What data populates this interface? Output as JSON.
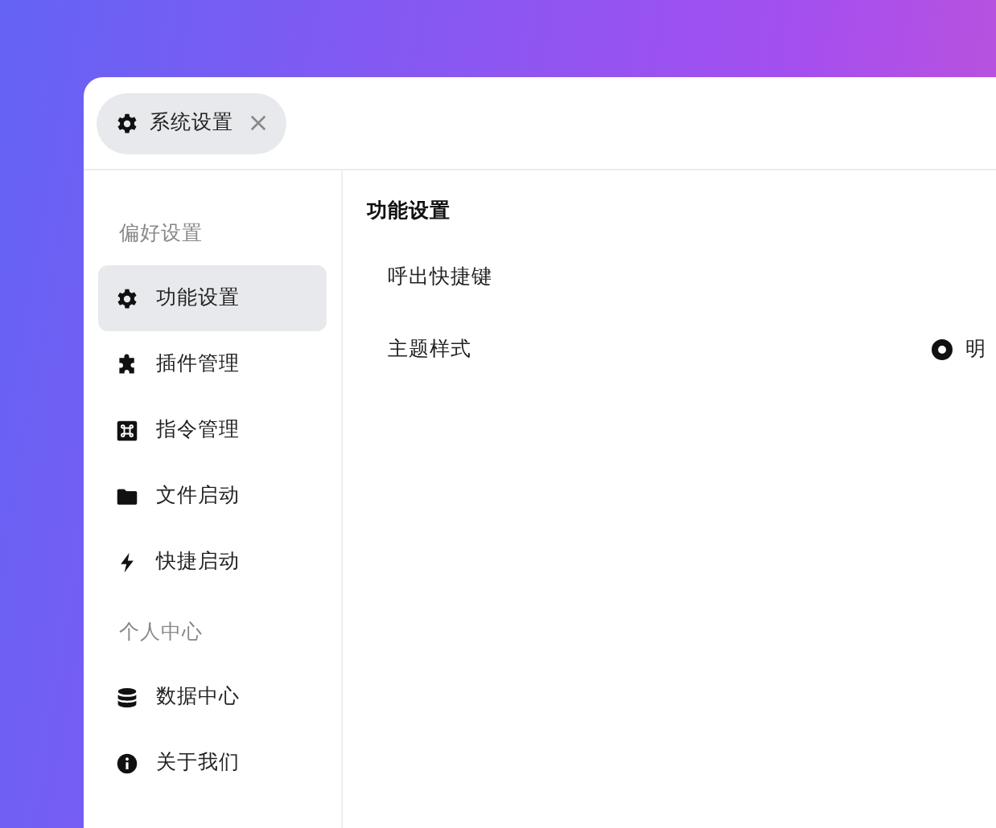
{
  "tab": {
    "label": "系统设置",
    "selected": true
  },
  "sidebar": {
    "items": [
      {
        "kind": "heading",
        "label": "偏好设置"
      },
      {
        "kind": "item",
        "label": "功能设置",
        "selected": true
      },
      {
        "kind": "item",
        "label": "插件管理",
        "selected": false
      },
      {
        "kind": "item",
        "label": "指令管理",
        "selected": false
      },
      {
        "kind": "item",
        "label": "文件启动",
        "selected": false
      },
      {
        "kind": "item",
        "label": "快捷启动",
        "selected": false
      },
      {
        "kind": "heading",
        "label": "个人中心"
      },
      {
        "kind": "item",
        "label": "数据中心",
        "selected": false
      },
      {
        "kind": "item",
        "label": "关于我们",
        "selected": false
      }
    ]
  },
  "content": {
    "title": "功能设置",
    "rows": [
      {
        "label": "呼出快捷键"
      },
      {
        "label": "主题样式",
        "radio": {
          "label": "明",
          "selected": true
        }
      }
    ]
  }
}
